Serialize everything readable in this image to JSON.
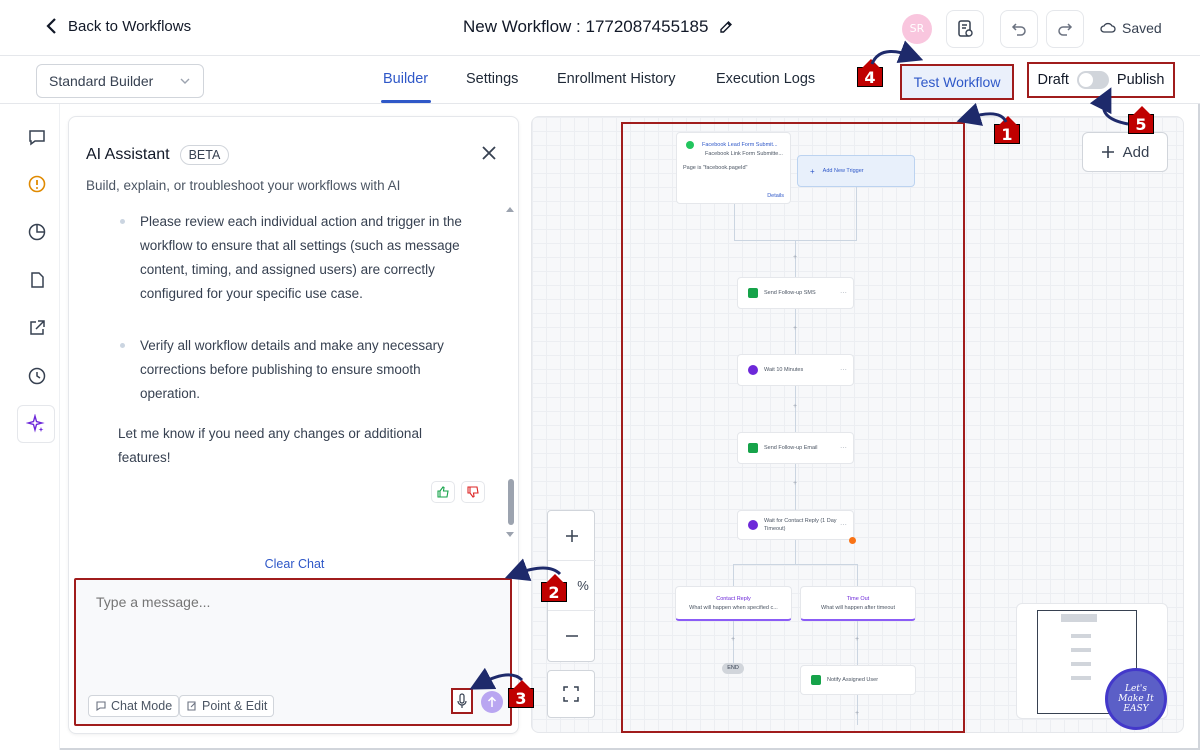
{
  "header": {
    "back_label": "Back to Workflows",
    "workflow_title": "New Workflow : 1772087455185",
    "avatar_initials": "SR",
    "saved_label": "Saved"
  },
  "nav": {
    "builder_select": "Standard Builder",
    "tabs": [
      {
        "label": "Builder",
        "active": true
      },
      {
        "label": "Settings"
      },
      {
        "label": "Enrollment History"
      },
      {
        "label": "Execution Logs"
      }
    ],
    "test_workflow": "Test Workflow",
    "draft_label": "Draft",
    "publish_label": "Publish"
  },
  "ai_panel": {
    "title": "AI Assistant",
    "badge": "BETA",
    "subtitle": "Build, explain, or troubleshoot your workflows with AI",
    "bullets": [
      "Please review each individual action and trigger in the workflow to ensure that all settings (such as message content, timing, and assigned users) are correctly configured for your specific use case.",
      "Verify all workflow details and make any necessary corrections before publishing to ensure smooth operation."
    ],
    "closing": "Let me know if you need any changes or additional features!",
    "clear_chat": "Clear Chat",
    "input_placeholder": "Type a message...",
    "chat_mode": "Chat Mode",
    "point_edit": "Point & Edit"
  },
  "canvas": {
    "add_label": "Add",
    "zoom_text": "%",
    "trigger": {
      "title": "Facebook Lead Form Submit...",
      "subtitle": "Facebook Link Form Submitte...",
      "filter": "Page is \"facebook.pageId\"",
      "details": "Details"
    },
    "add_trigger": "Add New Trigger",
    "actions": [
      "Send Follow-up SMS",
      "Wait 10 Minutes",
      "Send Follow-up Email",
      "Wait for Contact Reply (1 Day Timeout)"
    ],
    "branches": [
      {
        "title": "Contact Reply",
        "subtitle": "What will happen when specified c..."
      },
      {
        "title": "Time Out",
        "subtitle": "What will happen after timeout"
      }
    ],
    "end_label": "END",
    "notify": "Notify Assigned User"
  },
  "callouts": [
    "1",
    "2",
    "3",
    "4",
    "5"
  ],
  "badge_text": "Let's Make It EASY",
  "colors": {
    "accent": "#2f58c8",
    "annotation": "#a01c1c",
    "callout": "#c00000"
  }
}
